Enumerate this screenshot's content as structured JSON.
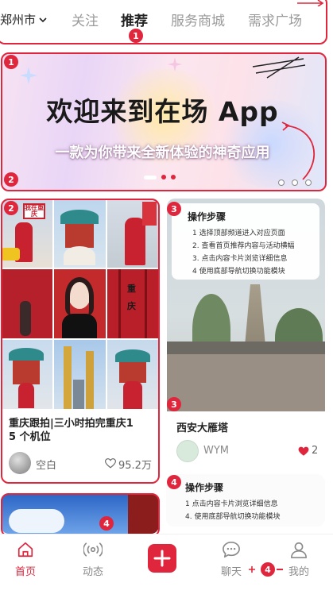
{
  "top_nav": {
    "city": "郑州市",
    "tabs": [
      {
        "label": "关注",
        "active": false
      },
      {
        "label": "推荐",
        "active": true
      },
      {
        "label": "服务商城",
        "active": false
      },
      {
        "label": "需求广场",
        "active": false
      }
    ]
  },
  "banner": {
    "title": "欢迎来到在场 App",
    "subtitle": "一款为你带来全新体验的神奇应用"
  },
  "feed": {
    "left_card": {
      "title": "重庆跟拍|三小时拍完重庆1 5 个机位",
      "user": "空白",
      "likes": "95.2万",
      "sign_text": "我在重庆",
      "door_text": "重庆"
    },
    "right_card": {
      "guide_title": "操作步骤",
      "guide_steps": [
        "1  选择顶部频道进入对应页面",
        "2. 查看首页推荐内容与活动横幅",
        "3. 点击内容卡片浏览详细信息",
        "4  使用底部导航切换功能模块"
      ],
      "title": "西安大雁塔",
      "user": "WYM",
      "likes": "2"
    },
    "right_card_2": {
      "guide_title": "操作步骤",
      "guide_steps": [
        "1  点击内容卡片浏览详细信息",
        "4. 使用底部导航切换功能模块"
      ]
    }
  },
  "bottom_nav": [
    {
      "label": "首页",
      "icon": "home-icon",
      "active": true
    },
    {
      "label": "动态",
      "icon": "broadcast-icon",
      "active": false
    },
    {
      "label": "",
      "icon": "plus-icon",
      "active": false
    },
    {
      "label": "聊天",
      "icon": "chat-icon",
      "active": false
    },
    {
      "label": "我的",
      "icon": "profile-icon",
      "active": false
    }
  ],
  "annotations": [
    "1",
    "1",
    "2",
    "2",
    "3",
    "3",
    "4",
    "4",
    "4"
  ],
  "colors": {
    "accent": "#e0263c",
    "text": "#222222",
    "muted": "#9a9a9a"
  }
}
